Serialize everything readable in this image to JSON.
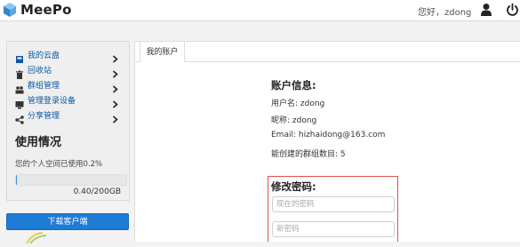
{
  "header": {
    "app_name": "MeePo",
    "greeting": "您好，zdong"
  },
  "sidebar": {
    "items": [
      {
        "label": "我的云盘",
        "icon": "cloud-drive-icon"
      },
      {
        "label": "回收站",
        "icon": "trash-icon"
      },
      {
        "label": "群组管理",
        "icon": "group-icon"
      },
      {
        "label": "管理登录设备",
        "icon": "device-icon"
      },
      {
        "label": "分享管理",
        "icon": "share-icon"
      }
    ],
    "usage": {
      "title": "使用情况",
      "text": "您的个人空间已使用0.2%",
      "used_fraction": 0.002,
      "amount": "0.40/200GB"
    },
    "download_label": "下载客户端"
  },
  "main": {
    "tab_label": "我的账户",
    "account": {
      "title": "账户信息:",
      "username": "用户名: zdong",
      "nickname": "昵称: zdong",
      "email": "Email:  hizhaidong@163.com",
      "groups": "能创建的群组数目:  5"
    },
    "password": {
      "title": "修改密码:",
      "current_placeholder": "现在的密码",
      "new_placeholder": "新密码"
    }
  },
  "colors": {
    "link": "#0e5aa0",
    "primary": "#1f7cd6",
    "highlight_border": "#d9534f"
  }
}
